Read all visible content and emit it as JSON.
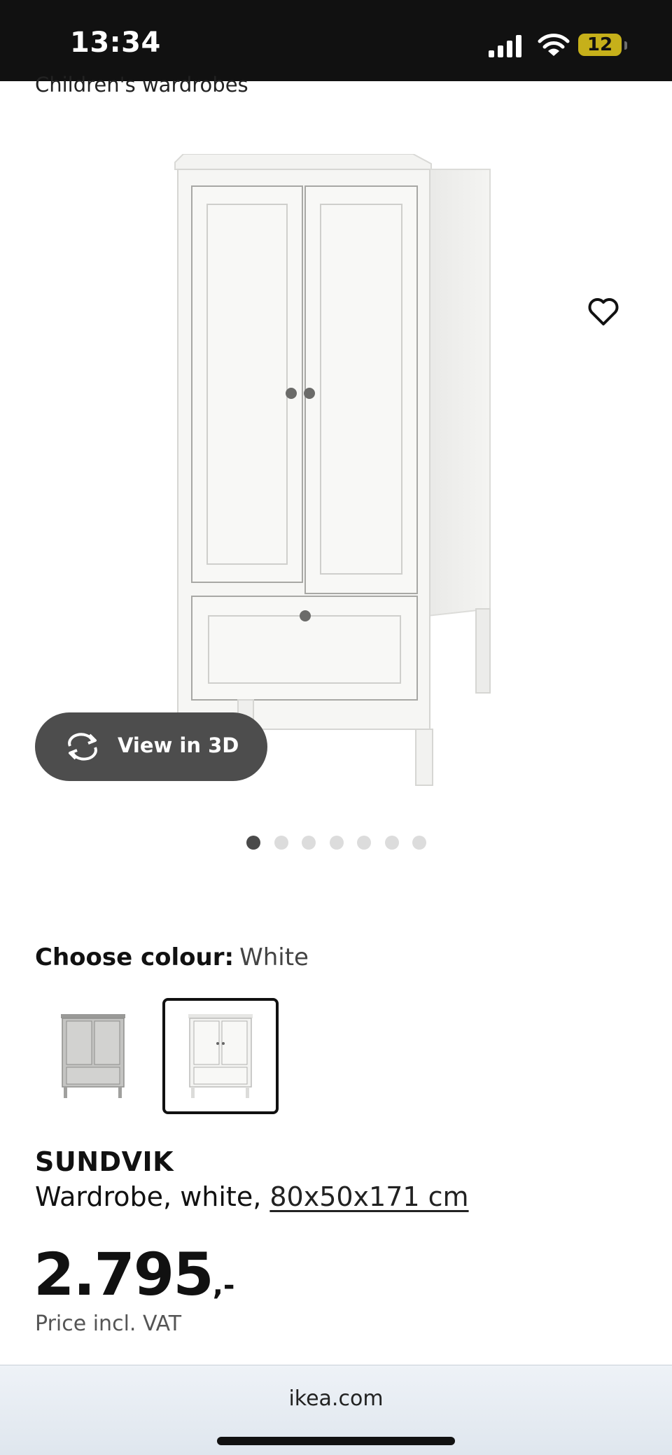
{
  "status_bar": {
    "time": "13:34",
    "battery": "12",
    "icons": [
      "signal-icon",
      "wifi-icon",
      "battery-icon"
    ]
  },
  "breadcrumb": "Children's wardrobes",
  "gallery": {
    "view_3d_label": "View in 3D",
    "image_count": 7,
    "active_index": 0,
    "icons": [
      "heart-icon",
      "rotate-3d-icon"
    ]
  },
  "colour": {
    "heading_label": "Choose colour:",
    "selected_value": "White",
    "options": [
      "Grey",
      "White"
    ],
    "selected_index": 1
  },
  "product": {
    "name": "SUNDVIK",
    "description": "Wardrobe, white, ",
    "dimensions": "80x50x171 cm"
  },
  "price": {
    "amount": "2.795",
    "suffix": ",-",
    "note": "Price incl. VAT"
  },
  "browser": {
    "url": "ikea.com"
  },
  "colors": {
    "status_bar": "#111111",
    "battery": "#c6b01a",
    "view3d_button": "#4d4d4d",
    "text": "#111111"
  }
}
